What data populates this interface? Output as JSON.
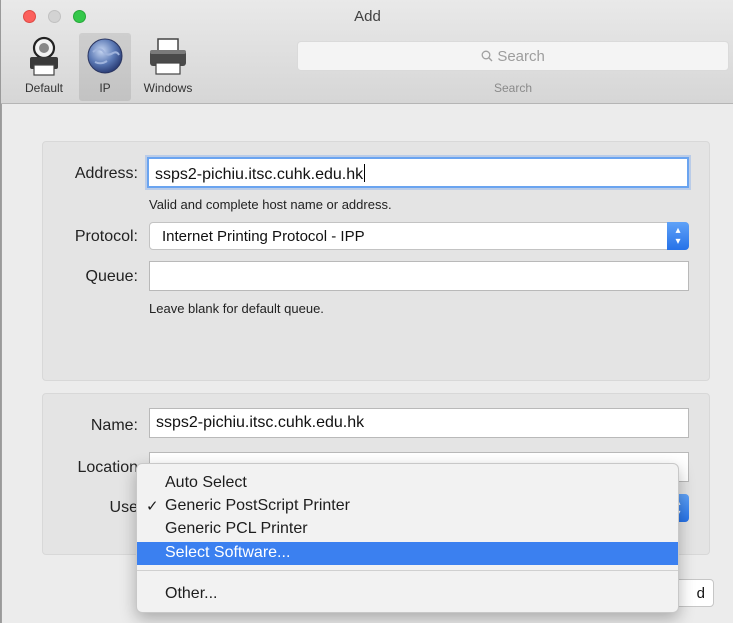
{
  "window": {
    "title": "Add"
  },
  "toolbar": {
    "items": [
      {
        "label": "Default",
        "icon": "default-printer-icon"
      },
      {
        "label": "IP",
        "icon": "globe-icon"
      },
      {
        "label": "Windows",
        "icon": "windows-printer-icon"
      }
    ],
    "search": {
      "placeholder": "Search",
      "label": "Search"
    }
  },
  "form": {
    "address": {
      "label": "Address:",
      "value": "ssps2-pichiu.itsc.cuhk.edu.hk",
      "hint": "Valid and complete host name or address."
    },
    "protocol": {
      "label": "Protocol:",
      "value": "Internet Printing Protocol - IPP"
    },
    "queue": {
      "label": "Queue:",
      "value": "",
      "hint": "Leave blank for default queue."
    },
    "name": {
      "label": "Name:",
      "value": "ssps2-pichiu.itsc.cuhk.edu.hk"
    },
    "location": {
      "label": "Location",
      "value": ""
    },
    "use": {
      "label": "Use"
    },
    "add_button": {
      "label": "d"
    }
  },
  "menu": {
    "items": [
      {
        "label": "Auto Select",
        "checked": false,
        "selected": false
      },
      {
        "label": "Generic PostScript Printer",
        "checked": true,
        "selected": false
      },
      {
        "label": "Generic PCL Printer",
        "checked": false,
        "selected": false
      },
      {
        "label": "Select Software...",
        "checked": false,
        "selected": true
      },
      {
        "label": "Other...",
        "checked": false,
        "selected": false
      }
    ],
    "check_glyph": "✓"
  },
  "colors": {
    "accent": "#3b80f0",
    "focus_ring": "#6aa4f0",
    "close": "#fc605c",
    "zoom": "#34c84a"
  }
}
